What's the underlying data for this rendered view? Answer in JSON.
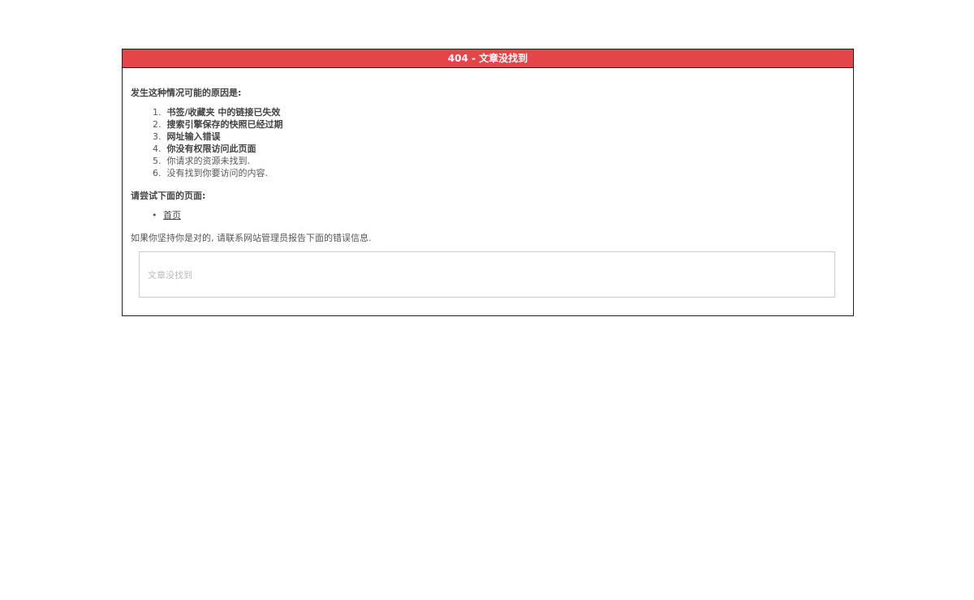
{
  "header": {
    "title": "404 - 文章没找到"
  },
  "body": {
    "reasons_heading": "发生这种情况可能的原因是:",
    "reasons": [
      {
        "num": "1.",
        "text": "书签/收藏夹 中的链接已失效"
      },
      {
        "num": "2.",
        "text": "搜索引擎保存的快照已经过期"
      },
      {
        "num": "3.",
        "text": "网址输入错误"
      },
      {
        "num": "4.",
        "text": "你没有权限访问此页面"
      },
      {
        "num": "5.",
        "text": "你请求的资源未找到."
      },
      {
        "num": "6.",
        "text": "没有找到你要访问的内容."
      }
    ],
    "suggest_heading": "请尝试下面的页面:",
    "suggest_links": [
      {
        "bullet": "•",
        "label": "首页"
      }
    ],
    "contact_text": "如果你坚持你是对的, 请联系网站管理员报告下面的错误信息.",
    "error_message": "文章没找到"
  },
  "colors": {
    "header_bg": "#e44549",
    "border": "#222222"
  }
}
